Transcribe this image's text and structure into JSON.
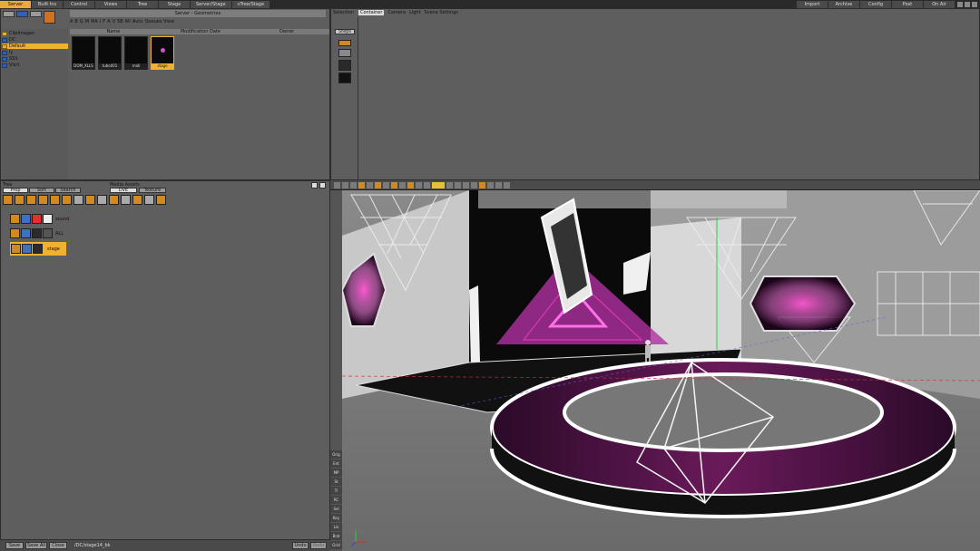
{
  "menubar": {
    "left_tabs": [
      "Server",
      "Built Ins",
      "Control",
      "Views",
      "Tree",
      "Stage",
      "Server/Stage",
      "vTree/Stage"
    ],
    "right_tabs": [
      "Import",
      "Archive",
      "Config",
      "Post",
      "On Air"
    ]
  },
  "server_panel": {
    "header": "Server - Geometries",
    "filter_tabs": [
      "A",
      "B",
      "G",
      "M",
      "MA",
      "I",
      "F",
      "A",
      "V",
      "SB",
      "All",
      "Auto",
      "Queues View"
    ],
    "columns": [
      "Name",
      "Modification Date",
      "Owner"
    ],
    "tree": [
      "ClipImages",
      "DC",
      "Default",
      "ly",
      "SSS",
      "Vlsrt"
    ],
    "items": [
      {
        "name": "DOM_XLLS"
      },
      {
        "name": "tubo001"
      },
      {
        "name": "mall"
      },
      {
        "name": "stage",
        "selected": true
      }
    ]
  },
  "scene_panel": {
    "selection_label": "Selection",
    "tabs": [
      "Container",
      "Camera",
      "Light",
      "Scene Settings"
    ],
    "steps_label": "Steps"
  },
  "tree_panel": {
    "title": "Tree",
    "subtabs": [
      "Prop",
      "Sort",
      "Search"
    ],
    "media_label": "Media Assets",
    "media_tabs": [
      "DVE",
      "Texture"
    ],
    "nodes": [
      {
        "label": "sound"
      },
      {
        "label": "ALL"
      },
      {
        "label": "stage",
        "selected": true
      }
    ]
  },
  "bottom_bar": {
    "save": "Save",
    "save_all": "Save All",
    "close": "Close",
    "path": "/DC/stage14_bk",
    "undo": "Undo",
    "redo": "Redo"
  },
  "viewport": {
    "side_buttons": [
      "Orig",
      "Ent",
      "MP",
      "St",
      "Tr",
      "RC",
      "Sel",
      "Key",
      "Lin",
      "Bnd",
      "Grid"
    ]
  }
}
